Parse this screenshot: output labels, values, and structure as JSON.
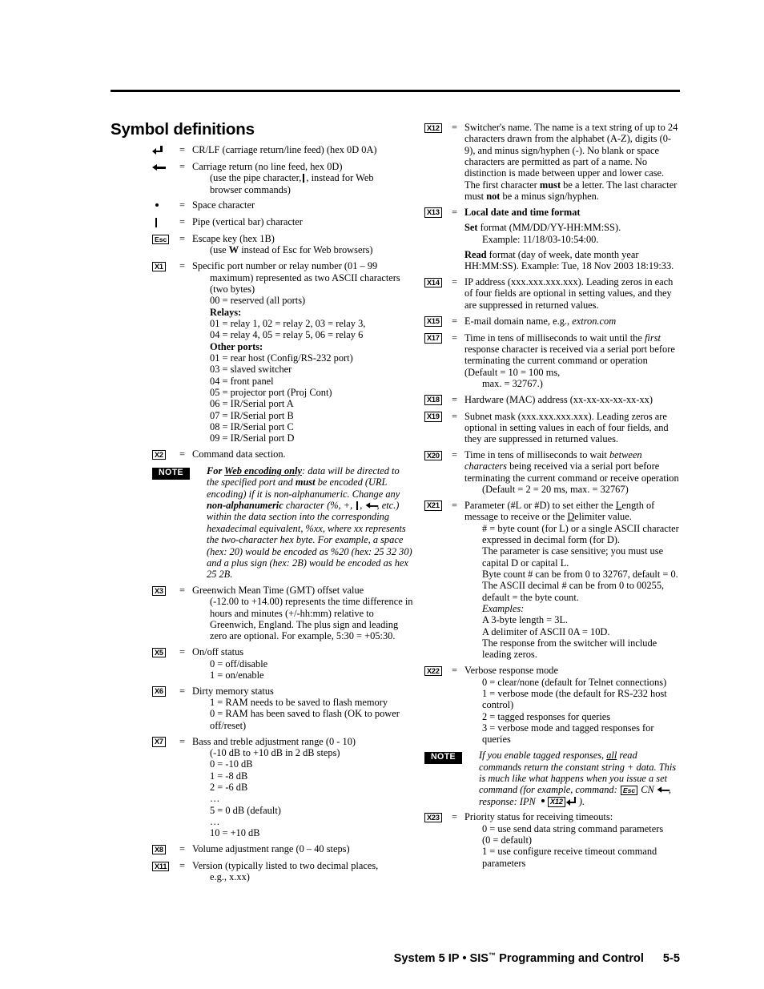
{
  "page": {
    "title": "Symbol definitions",
    "footer": {
      "product": "System 5 IP",
      "separator": "•",
      "section": "SIS",
      "trademark": "™",
      "section_tail": " Programming and Control",
      "page_number": "5-5"
    }
  },
  "left_column": {
    "symbols": [
      {
        "tag": "crlf-arrow-icon",
        "eq": "=",
        "lines": [
          "CR/LF (carriage return/line feed) (hex 0D 0A)"
        ]
      },
      {
        "tag": "carriage-return-arrow-icon",
        "eq": "=",
        "lines": [
          "Carriage return (no line feed, hex 0D)",
          "(use the pipe character,",
          ", instead for Web",
          "browser commands)"
        ]
      },
      {
        "tag": "space-bullet-icon",
        "eq": "=",
        "lines": [
          "Space character"
        ]
      },
      {
        "tag": "pipe-icon",
        "eq": "=",
        "lines": [
          "Pipe (vertical bar) character"
        ]
      },
      {
        "tag": "Esc",
        "eq": "=",
        "lines": [
          "Escape key (hex 1B)",
          "(use ",
          "W",
          " instead of Esc for Web browsers)"
        ]
      }
    ],
    "x1": {
      "tag": "X1",
      "eq": "=",
      "title": "Specific port number or relay number (01 – 99",
      "title_cont": "maximum) represented as two ASCII characters",
      "title_cont2": "(two bytes)",
      "reserved": "00 = reserved (all ports)",
      "relays_heading": "Relays:",
      "relays": [
        "01 = relay 1,  02 = relay 2, 03 = relay 3,",
        "04 = relay 4, 05 = relay 5, 06 = relay 6"
      ],
      "other_heading": "Other ports:",
      "other_ports": [
        "01 = rear host (Config/RS-232 port)",
        "03 = slaved switcher",
        "04 = front panel",
        "05 = projector port (Proj Cont)",
        "06 = IR/Serial port A",
        "07 = IR/Serial port B",
        "08 = IR/Serial port C",
        "09 = IR/Serial port D"
      ]
    },
    "x2": {
      "tag": "X2",
      "eq": "=",
      "text": "Command data section."
    },
    "note1": {
      "badge": "NOTE",
      "lead": "For ",
      "emph": "Web encoding only",
      "part1": ": data will be directed to the specified port and ",
      "bold1": "must",
      "part2": " be encoded (URL encoding) if it is non-alphanumeric.  Change any ",
      "bold2": "non-alphanumeric",
      "part3": " character (%, +, ",
      "part3b": ", ",
      "part4": ", etc.) within the data section into the corresponding hexadecimal equivalent, %xx, where xx represents the two-character hex byte.  For example, a space (hex: 20) would be encoded as %20 (hex: 25 32 30) and a plus sign (hex: 2B) would be encoded as hex 25 2B."
    },
    "x3": {
      "tag": "X3",
      "eq": "=",
      "title": "Greenwich Mean Time (GMT) offset value",
      "body": "(-12.00 to +14.00) represents the time difference in hours and minutes (+/-hh:mm) relative to Greenwich, England.  The plus sign and leading zero are optional.  For example, 5:30 = +05:30."
    },
    "x5": {
      "tag": "X5",
      "eq": "=",
      "title": "On/off status",
      "values": [
        "0 = off/disable",
        "1 = on/enable"
      ]
    },
    "x6": {
      "tag": "X6",
      "eq": "=",
      "title": "Dirty memory status",
      "values": [
        "1 = RAM needs to be saved to flash memory",
        "0 = RAM has been saved to flash (OK to power off/reset)"
      ]
    },
    "x7": {
      "tag": "X7",
      "eq": "=",
      "title": "Bass and treble adjustment range (0 - 10)",
      "values": [
        "(-10 dB to +10 dB in 2 dB steps)",
        "0 = -10 dB",
        "1 = -8 dB",
        "2 = -6 dB",
        "…",
        "5 = 0 dB (default)",
        "…",
        "10 = +10 dB"
      ]
    },
    "x8": {
      "tag": "X8",
      "eq": "=",
      "title": "Volume adjustment range (0 – 40 steps)"
    },
    "x11": {
      "tag": "X11",
      "eq": "=",
      "title": "Version (typically listed to two decimal places,",
      "cont": "e.g., x.xx)"
    }
  },
  "right_column": {
    "x12": {
      "tag": "X12",
      "eq": "=",
      "part1": "Switcher's name.  The name is a text string of up to 24 characters drawn from the alphabet (A-Z), digits (0-9), and minus sign/hyphen (-).  No blank or space characters are permitted as part of a name.   No distinction is made between upper and lower case.  The first character ",
      "bold1": "must",
      "part2": " be a letter.  The last character must ",
      "bold2": "not",
      "part3": " be a minus sign/hyphen."
    },
    "x13": {
      "tag": "X13",
      "eq": "=",
      "title": "Local date and time format",
      "set_label": "Set",
      "set_text": " format (MM/DD/YY-HH:MM:SS).",
      "set_example": "Example: 11/18/03-10:54:00.",
      "read_label": "Read",
      "read_text": " format (day of week, date month year HH:MM:SS).  Example: Tue, 18 Nov 2003 18:19:33."
    },
    "x14": {
      "tag": "X14",
      "eq": "=",
      "text": "IP address (xxx.xxx.xxx.xxx).  Leading zeros in each of four fields are optional in setting values, and they are suppressed in returned values."
    },
    "x15": {
      "tag": "X15",
      "eq": "=",
      "text": "E-mail domain name, e.g., ",
      "italic": "extron.com"
    },
    "x17": {
      "tag": "X17",
      "eq": "=",
      "part1": "Time in tens of milliseconds to wait until the ",
      "italic": "first",
      "part2": " response character is received via a serial port before terminating the current command or operation  (Default = 10 = 100 ms,",
      "part3": "max. = 32767.)"
    },
    "x18": {
      "tag": "X18",
      "eq": "=",
      "text": "Hardware (MAC) address (xx-xx-xx-xx-xx-xx)"
    },
    "x19": {
      "tag": "X19",
      "eq": "=",
      "text": "Subnet mask (xxx.xxx.xxx.xxx).  Leading zeros are optional in setting values in each of four fields, and they are suppressed in returned values."
    },
    "x20": {
      "tag": "X20",
      "eq": "=",
      "part1": "Time in tens of milliseconds to wait ",
      "italic1": "between characters",
      "part2": " being received via a serial port before terminating the current command or receive operation",
      "part3": "(Default = 2 = 20 ms, max. = 32767)"
    },
    "x21": {
      "tag": "X21",
      "eq": "=",
      "part1": "Parameter (#L or #D) to set either the ",
      "u1": "L",
      "part2": "ength of message to receive or the ",
      "u2": "D",
      "part3": "elimiter value.",
      "lines": [
        "# = byte count (for L) or a single ASCII character expressed in decimal form (for D).",
        "The parameter is case sensitive; you must use capital D or capital L.",
        "Byte count # can be from 0 to 32767, default = 0.",
        "The ASCII decimal # can be from 0 to 00255, default = the byte count."
      ],
      "examples_label": "Examples:",
      "examples": [
        "A 3-byte length = 3L.",
        "A delimiter of ASCII 0A = 10D.",
        "The response from the switcher will include leading zeros."
      ]
    },
    "x22": {
      "tag": "X22",
      "eq": "=",
      "title": "Verbose response mode",
      "values": [
        "0 = clear/none (default for Telnet connections)",
        "1 = verbose mode (the default for RS-232 host control)",
        "2 = tagged responses for queries",
        "3 = verbose mode and tagged responses for queries"
      ]
    },
    "note2": {
      "badge": "NOTE",
      "part1": "If you enable tagged responses, ",
      "u1": "all",
      "part2": " read commands return the constant string + data.  This is much like what happens when you issue a set command (for example, command: ",
      "esc_tag": "Esc",
      "part3": " CN ",
      "part4": ",",
      "part5": "response: IPN ",
      "part6": " ",
      "x12_tag": "X12",
      "part7": " )."
    },
    "x23": {
      "tag": "X23",
      "eq": "=",
      "title": "Priority status for receiving timeouts:",
      "values": [
        "0 = use send data string command parameters",
        "(0 = default)",
        "1 = use configure receive timeout command parameters"
      ]
    }
  }
}
